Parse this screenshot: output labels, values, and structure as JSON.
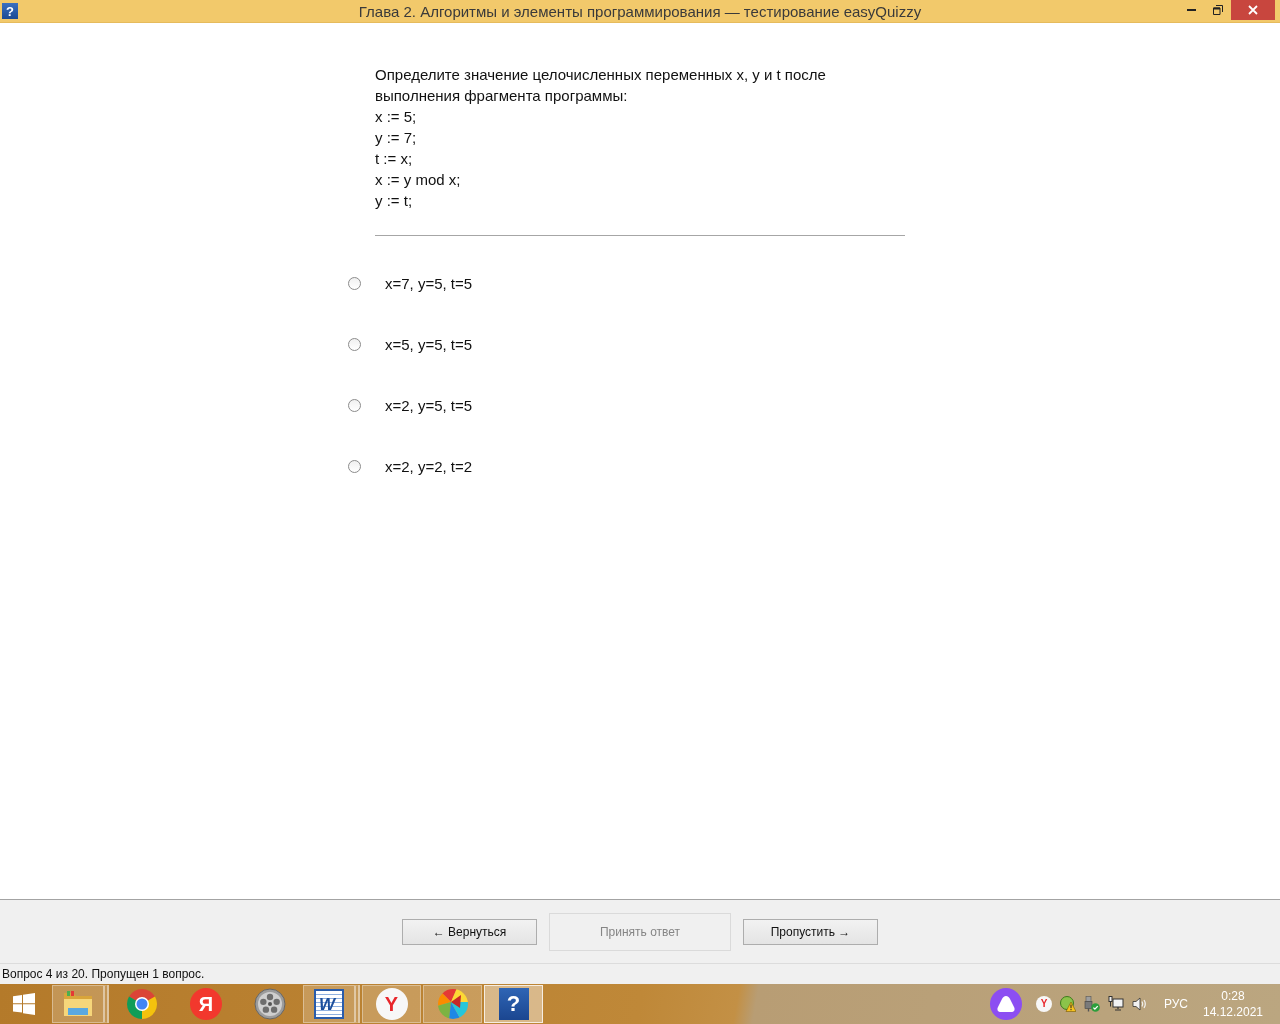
{
  "window": {
    "icon_glyph": "?",
    "title": "Глава 2. Алгоритмы и элементы программирования — тестирование easyQuizzy"
  },
  "question": {
    "prompt": "Определите значение целочисленных переменных x, y и t после выполнения фрагмента программы:",
    "code_lines": [
      "x := 5;",
      "y := 7;",
      "t := x;",
      "x := y mod x;",
      "y := t;"
    ]
  },
  "options": [
    {
      "label": "x=7, y=5, t=5",
      "selected": false
    },
    {
      "label": "x=5, y=5, t=5",
      "selected": false
    },
    {
      "label": "x=2, y=5, t=5",
      "selected": false
    },
    {
      "label": "x=2, y=2, t=2",
      "selected": false
    }
  ],
  "buttons": [
    {
      "label": "← Вернуться",
      "disabled": false
    },
    {
      "label": "Принять ответ",
      "disabled": true
    },
    {
      "label": "Пропустить →",
      "disabled": false
    }
  ],
  "status_bar": {
    "text": "Вопрос 4 из 20. Пропущен 1 вопрос."
  },
  "taskbar": {
    "items": [
      {
        "kind": "folder",
        "running": true,
        "stacked": true,
        "selected": false
      },
      {
        "kind": "ring",
        "running": false,
        "stacked": false,
        "selected": false
      },
      {
        "kind": "letter",
        "glyph": "Я",
        "running": false,
        "stacked": false,
        "selected": false
      },
      {
        "kind": "reel",
        "running": false,
        "stacked": false,
        "selected": false
      },
      {
        "kind": "doc",
        "glyph": "W",
        "running": true,
        "stacked": true,
        "selected": false
      },
      {
        "kind": "letter_white",
        "glyph": "Y",
        "running": true,
        "stacked": false,
        "selected": false
      },
      {
        "kind": "poly",
        "running": true,
        "stacked": false,
        "selected": false
      },
      {
        "kind": "tile",
        "glyph": "?",
        "running": true,
        "stacked": false,
        "selected": true
      }
    ],
    "tray": {
      "icons": [
        {
          "kind": "assistant"
        },
        {
          "kind": "letter_white",
          "glyph": "Y"
        },
        {
          "kind": "warning"
        },
        {
          "kind": "usb"
        },
        {
          "kind": "network"
        },
        {
          "kind": "volume"
        }
      ],
      "language": "РУС",
      "time": "0:28",
      "date": "14.12.2021"
    }
  }
}
